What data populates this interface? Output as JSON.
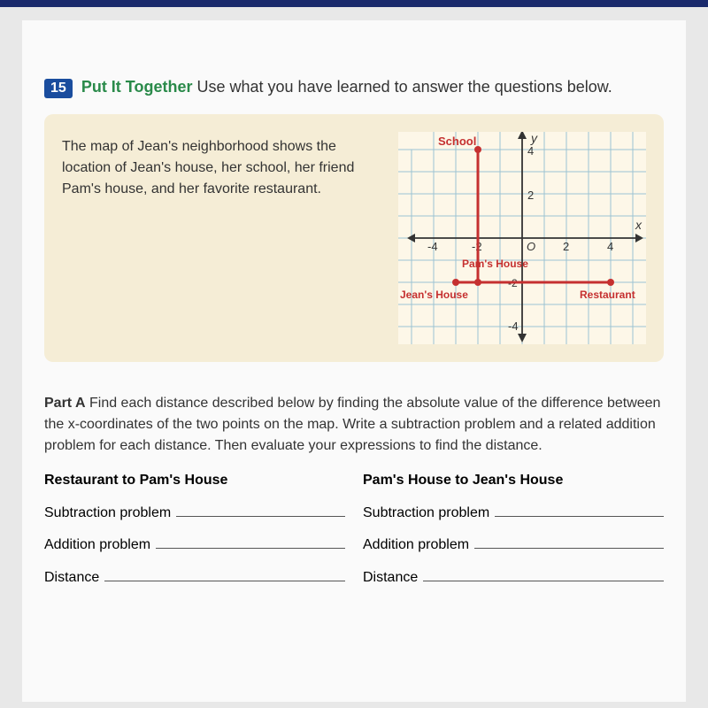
{
  "header": {
    "number": "15",
    "title": "Put It Together",
    "instruction": "Use what you have learned to answer the questions below."
  },
  "panel": {
    "text": "The map of Jean's neighborhood shows the location of Jean's house, her school, her friend Pam's house, and her favorite restaurant."
  },
  "graph": {
    "axis_y_label": "y",
    "axis_x_label": "x",
    "ticks_x": [
      "-4",
      "-2",
      "O",
      "2",
      "4"
    ],
    "tick_y_4": "4",
    "tick_y_2": "2",
    "tick_y_neg2_overlay": "-2",
    "tick_y_neg4": "-4",
    "school_label": "School",
    "pam_label": "Pam's House",
    "jean_label": "Jean's House",
    "restaurant_label": "Restaurant",
    "points": {
      "school": {
        "x": -2,
        "y": 4
      },
      "pam_house": {
        "x": -2,
        "y": -2
      },
      "jean_house": {
        "x": -3,
        "y": -2
      },
      "restaurant": {
        "x": 4,
        "y": -2
      }
    }
  },
  "partA": {
    "label": "Part A",
    "text": "Find each distance described below by finding the absolute value of the difference between the x-coordinates of the two points on the map. Write a subtraction problem and a related addition problem for each distance. Then evaluate your expressions to find the distance.",
    "left": {
      "head": "Restaurant to Pam's House",
      "rows": [
        "Subtraction problem",
        "Addition problem",
        "Distance"
      ]
    },
    "right": {
      "head": "Pam's House to Jean's House",
      "rows": [
        "Subtraction problem",
        "Addition problem",
        "Distance"
      ]
    }
  },
  "chart_data": {
    "type": "scatter",
    "title": "",
    "xlabel": "x",
    "ylabel": "y",
    "xlim": [
      -5,
      5
    ],
    "ylim": [
      -5,
      5
    ],
    "series": [
      {
        "name": "School",
        "x": -2,
        "y": 4
      },
      {
        "name": "Pam's House",
        "x": -2,
        "y": -2
      },
      {
        "name": "Jean's House",
        "x": -3,
        "y": -2
      },
      {
        "name": "Restaurant",
        "x": 4,
        "y": -2
      }
    ],
    "segments": [
      {
        "from": "School",
        "to": "Pam's House"
      },
      {
        "from": "Jean's House",
        "to": "Restaurant"
      }
    ]
  }
}
